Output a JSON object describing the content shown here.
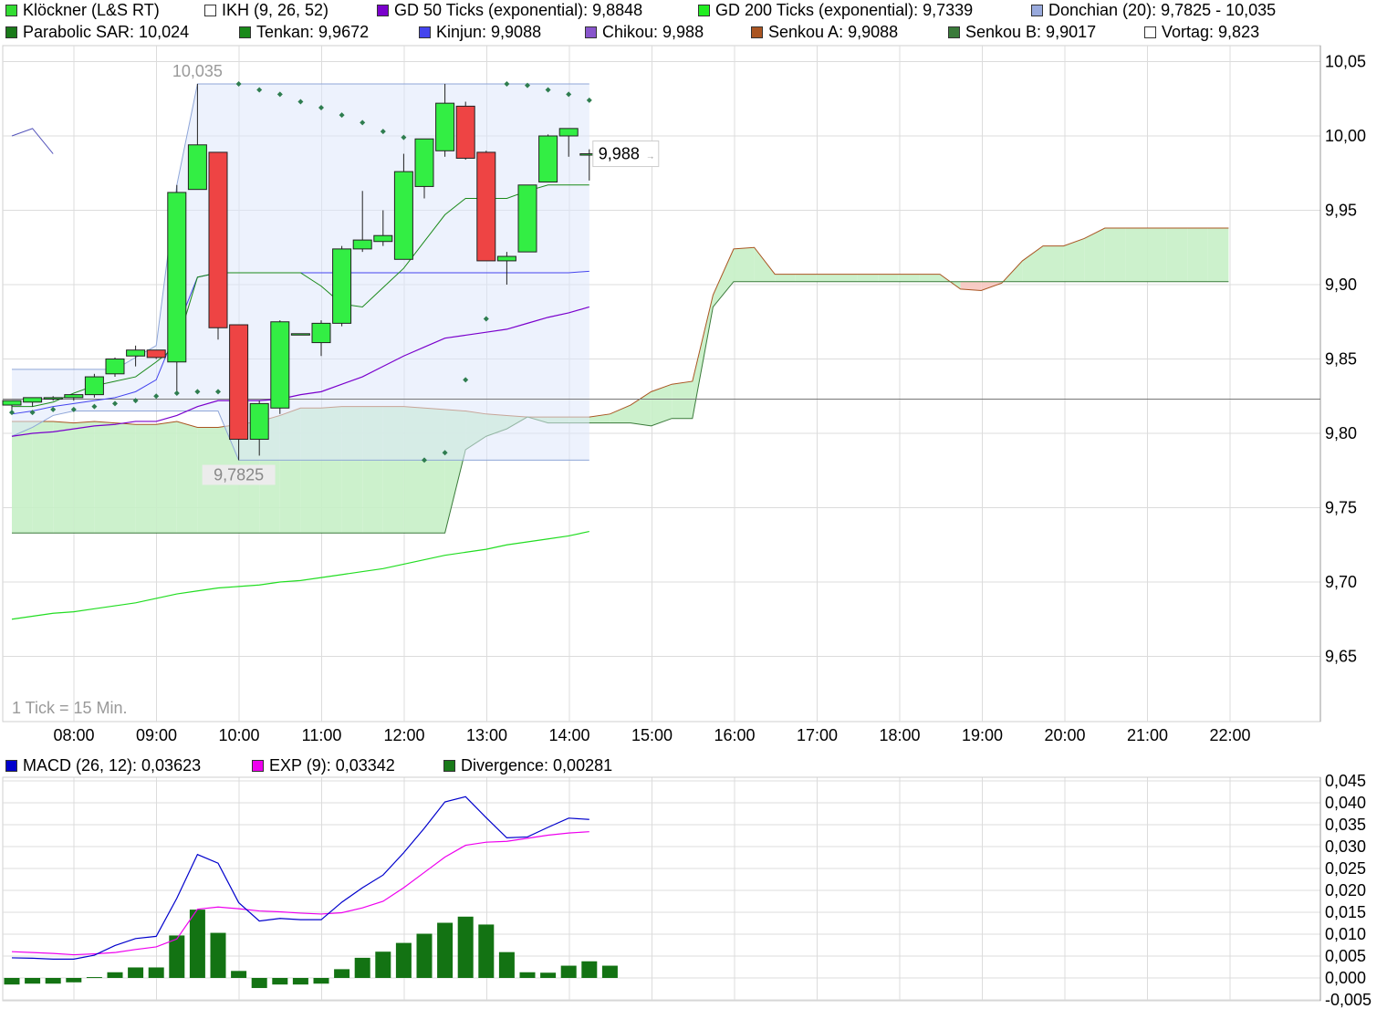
{
  "legend_top": [
    {
      "label": "Klöckner (L&S RT)",
      "color": "#33dd33"
    },
    {
      "label": "IKH (9, 26, 52)",
      "color": "#ffffff"
    },
    {
      "label": "GD 50 Ticks (exponential): 9,8848",
      "color": "#7a00cc"
    },
    {
      "label": "GD 200 Ticks (exponential): 9,7339",
      "color": "#22ee22"
    },
    {
      "label": "Donchian (20): 9,7825 - 10,035",
      "color": "#99aadd"
    },
    {
      "label": "Parabolic SAR: 10,024",
      "color": "#1a7a1a"
    },
    {
      "label": "Tenkan: 9,9672",
      "color": "#1a8a1a"
    },
    {
      "label": "Kinjun: 9,9088",
      "color": "#4444ee"
    },
    {
      "label": "Chikou: 9,988",
      "color": "#8855cc"
    },
    {
      "label": "Senkou A: 9,9088",
      "color": "#aa5522"
    },
    {
      "label": "Senkou B: 9,9017",
      "color": "#3a7a3a"
    },
    {
      "label": "Vortag: 9,823",
      "color": "#ffffff"
    }
  ],
  "legend_macd": [
    {
      "label": "MACD (26, 12): 0,03623",
      "color": "#0000cc"
    },
    {
      "label": "EXP (9): 0,03342",
      "color": "#ee00ee"
    },
    {
      "label": "Divergence: 0,00281",
      "color": "#1a7a1a"
    }
  ],
  "tick_note": "1 Tick = 15 Min.",
  "annotations": {
    "high": "10,035",
    "low": "9,7825",
    "last": "9,988"
  },
  "chart_data": [
    {
      "type": "candlestick",
      "title": "Klöckner (L&S RT)",
      "x_labels": [
        "08:00",
        "09:00",
        "10:00",
        "11:00",
        "12:00",
        "13:00",
        "14:00",
        "15:00",
        "16:00",
        "17:00",
        "18:00",
        "19:00",
        "20:00",
        "21:00",
        "22:00"
      ],
      "y_labels": [
        "10,05",
        "10,00",
        "9,95",
        "9,90",
        "9,85",
        "9,80",
        "9,75",
        "9,70",
        "9,65"
      ],
      "ylim": [
        9.615,
        10.063
      ],
      "vortag": 9.823,
      "candles": [
        {
          "t": "07:30",
          "o": 9.819,
          "h": 9.822,
          "l": 9.815,
          "c": 9.822
        },
        {
          "t": "07:45",
          "o": 9.821,
          "h": 9.824,
          "l": 9.818,
          "c": 9.824
        },
        {
          "t": "08:00",
          "o": 9.823,
          "h": 9.825,
          "l": 9.822,
          "c": 9.824
        },
        {
          "t": "08:15",
          "o": 9.824,
          "h": 9.826,
          "l": 9.822,
          "c": 9.826
        },
        {
          "t": "08:30",
          "o": 9.826,
          "h": 9.84,
          "l": 9.824,
          "c": 9.838
        },
        {
          "t": "08:45",
          "o": 9.84,
          "h": 9.851,
          "l": 9.838,
          "c": 9.85
        },
        {
          "t": "09:00",
          "o": 9.852,
          "h": 9.859,
          "l": 9.845,
          "c": 9.856
        },
        {
          "t": "09:15",
          "o": 9.856,
          "h": 9.856,
          "l": 9.85,
          "c": 9.851
        },
        {
          "t": "09:30",
          "o": 9.848,
          "h": 9.967,
          "l": 9.828,
          "c": 9.962
        },
        {
          "t": "09:45",
          "o": 9.964,
          "h": 10.035,
          "l": 9.964,
          "c": 9.994
        },
        {
          "t": "10:00",
          "o": 9.989,
          "h": 9.989,
          "l": 9.863,
          "c": 9.871
        },
        {
          "t": "10:15",
          "o": 9.873,
          "h": 9.873,
          "l": 9.782,
          "c": 9.796
        },
        {
          "t": "10:30",
          "o": 9.796,
          "h": 9.822,
          "l": 9.785,
          "c": 9.82
        },
        {
          "t": "10:45",
          "o": 9.817,
          "h": 9.876,
          "l": 9.813,
          "c": 9.875
        },
        {
          "t": "11:00",
          "o": 9.867,
          "h": 9.867,
          "l": 9.866,
          "c": 9.867
        },
        {
          "t": "11:15",
          "o": 9.861,
          "h": 9.876,
          "l": 9.852,
          "c": 9.874
        },
        {
          "t": "11:30",
          "o": 9.874,
          "h": 9.926,
          "l": 9.872,
          "c": 9.924
        },
        {
          "t": "11:45",
          "o": 9.924,
          "h": 9.963,
          "l": 9.922,
          "c": 9.93
        },
        {
          "t": "12:00",
          "o": 9.929,
          "h": 9.95,
          "l": 9.926,
          "c": 9.933
        },
        {
          "t": "12:15",
          "o": 9.917,
          "h": 9.988,
          "l": 9.917,
          "c": 9.976
        },
        {
          "t": "12:30",
          "o": 9.966,
          "h": 9.998,
          "l": 9.958,
          "c": 9.998
        },
        {
          "t": "12:45",
          "o": 9.99,
          "h": 10.035,
          "l": 9.986,
          "c": 10.022
        },
        {
          "t": "13:00",
          "o": 10.02,
          "h": 10.023,
          "l": 9.984,
          "c": 9.985
        },
        {
          "t": "13:15",
          "o": 9.989,
          "h": 9.99,
          "l": 9.916,
          "c": 9.916
        },
        {
          "t": "13:30",
          "o": 9.916,
          "h": 9.922,
          "l": 9.9,
          "c": 9.919
        },
        {
          "t": "13:45",
          "o": 9.922,
          "h": 9.967,
          "l": 9.922,
          "c": 9.967
        },
        {
          "t": "14:00",
          "o": 9.969,
          "h": 10.001,
          "l": 9.969,
          "c": 10.0
        },
        {
          "t": "14:15",
          "o": 10.0,
          "h": 10.005,
          "l": 9.986,
          "c": 10.005
        },
        {
          "t": "14:30",
          "o": 9.988,
          "h": 9.991,
          "l": 9.97,
          "c": 9.988
        }
      ],
      "sar": [
        9.814,
        9.814,
        9.816,
        9.816,
        9.818,
        9.82,
        9.822,
        9.825,
        9.827,
        9.828,
        9.828,
        10.035,
        10.031,
        10.028,
        10.023,
        10.019,
        10.014,
        10.009,
        10.003,
        9.999,
        9.782,
        9.787,
        9.836,
        9.877,
        10.035,
        10.034,
        10.031,
        10.028,
        10.024
      ],
      "gd50": [
        9.798,
        9.8,
        9.801,
        9.803,
        9.805,
        9.806,
        9.808,
        9.808,
        9.812,
        9.818,
        9.822,
        9.822,
        9.822,
        9.823,
        9.826,
        9.828,
        9.833,
        9.838,
        9.845,
        9.852,
        9.858,
        9.864,
        9.866,
        9.868,
        9.87,
        9.874,
        9.878,
        9.881,
        9.885
      ],
      "gd200": [
        9.675,
        9.677,
        9.679,
        9.68,
        9.682,
        9.684,
        9.686,
        9.689,
        9.692,
        9.694,
        9.696,
        9.697,
        9.698,
        9.7,
        9.701,
        9.703,
        9.705,
        9.707,
        9.709,
        9.712,
        9.715,
        9.718,
        9.72,
        9.722,
        9.725,
        9.727,
        9.729,
        9.731,
        9.734
      ],
      "tenkan": [
        9.818,
        9.818,
        9.821,
        9.827,
        9.832,
        9.835,
        9.838,
        9.848,
        9.859,
        9.905,
        9.908,
        9.908,
        9.908,
        9.908,
        9.908,
        9.899,
        9.887,
        9.885,
        9.898,
        9.911,
        9.929,
        9.947,
        9.958,
        9.958,
        9.958,
        9.963,
        9.967,
        9.967,
        9.967
      ],
      "kinjun": [
        9.813,
        9.815,
        9.818,
        9.82,
        9.822,
        9.824,
        9.828,
        9.836,
        9.87,
        9.905,
        9.908,
        9.908,
        9.908,
        9.908,
        9.908,
        9.908,
        9.908,
        9.908,
        9.908,
        9.908,
        9.908,
        9.908,
        9.908,
        9.908,
        9.908,
        9.908,
        9.908,
        9.908,
        9.909
      ],
      "chikou": [
        10.0,
        10.005,
        9.988
      ],
      "donchian_high": [
        9.843,
        9.843,
        9.843,
        9.843,
        9.843,
        9.843,
        9.851,
        9.859,
        9.967,
        10.035,
        10.035,
        10.035,
        10.035,
        10.035,
        10.035,
        10.035,
        10.035,
        10.035,
        10.035,
        10.035,
        10.035,
        10.035,
        10.035,
        10.035,
        10.035,
        10.035,
        10.035,
        10.035,
        10.035
      ],
      "donchian_low": [
        9.798,
        9.804,
        9.812,
        9.815,
        9.815,
        9.815,
        9.815,
        9.815,
        9.815,
        9.815,
        9.815,
        9.782,
        9.782,
        9.782,
        9.782,
        9.782,
        9.782,
        9.782,
        9.782,
        9.782,
        9.782,
        9.782,
        9.782,
        9.782,
        9.782,
        9.782,
        9.782,
        9.782,
        9.782
      ],
      "senkou_a": [
        9.808,
        9.808,
        9.808,
        9.807,
        9.808,
        9.807,
        9.806,
        9.806,
        9.808,
        9.804,
        9.804,
        9.806,
        9.808,
        9.812,
        9.817,
        9.817,
        9.818,
        9.818,
        9.818,
        9.818,
        9.817,
        9.816,
        9.815,
        9.813,
        9.812,
        9.811,
        9.811,
        9.811,
        9.811,
        9.813,
        9.819,
        9.828,
        9.833,
        9.835,
        9.893,
        9.924,
        9.925,
        9.907,
        9.907,
        9.907,
        9.907,
        9.907,
        9.907,
        9.907,
        9.907,
        9.907,
        9.897,
        9.896,
        9.901,
        9.916,
        9.926,
        9.926,
        9.931,
        9.938,
        9.938,
        9.938,
        9.938,
        9.938,
        9.938,
        9.938
      ],
      "senkou_b": [
        9.733,
        9.733,
        9.733,
        9.733,
        9.733,
        9.733,
        9.733,
        9.733,
        9.733,
        9.733,
        9.733,
        9.733,
        9.733,
        9.733,
        9.733,
        9.733,
        9.733,
        9.733,
        9.733,
        9.733,
        9.733,
        9.733,
        9.789,
        9.798,
        9.803,
        9.811,
        9.807,
        9.807,
        9.807,
        9.807,
        9.807,
        9.805,
        9.81,
        9.81,
        9.885,
        9.902,
        9.902,
        9.902,
        9.902,
        9.902,
        9.902,
        9.902,
        9.902,
        9.902,
        9.902,
        9.902,
        9.902,
        9.902,
        9.902,
        9.902,
        9.902,
        9.902,
        9.902,
        9.902,
        9.902,
        9.902,
        9.902,
        9.902,
        9.902,
        9.902
      ]
    },
    {
      "type": "line_bar",
      "title": "MACD (26, 12)",
      "x_labels": [
        "08:00",
        "09:00",
        "10:00",
        "11:00",
        "12:00",
        "13:00",
        "14:00",
        "15:00",
        "16:00",
        "17:00",
        "18:00",
        "19:00",
        "20:00",
        "21:00",
        "22:00"
      ],
      "y_labels": [
        "0,045",
        "0,040",
        "0,035",
        "0,030",
        "0,025",
        "0,020",
        "0,015",
        "0,010",
        "0,005",
        "0,000",
        "-0,005"
      ],
      "ylim": [
        -0.0055,
        0.0455
      ],
      "macd": [
        0.0046,
        0.0045,
        0.0043,
        0.0043,
        0.0052,
        0.0074,
        0.009,
        0.0095,
        0.0182,
        0.0282,
        0.0262,
        0.0172,
        0.013,
        0.0136,
        0.0133,
        0.0133,
        0.0173,
        0.0206,
        0.0235,
        0.0286,
        0.0342,
        0.0402,
        0.0414,
        0.0366,
        0.032,
        0.0322,
        0.0344,
        0.0365,
        0.0362
      ],
      "exp": [
        0.006,
        0.0058,
        0.0056,
        0.0053,
        0.0055,
        0.0058,
        0.0065,
        0.0071,
        0.0089,
        0.0157,
        0.0162,
        0.0158,
        0.0153,
        0.0151,
        0.0148,
        0.0146,
        0.0149,
        0.016,
        0.0175,
        0.0206,
        0.0241,
        0.0276,
        0.0303,
        0.031,
        0.0312,
        0.0319,
        0.0326,
        0.0331,
        0.0334
      ],
      "divergence": [
        -0.0015,
        -0.0013,
        -0.0013,
        -0.001,
        0.0002,
        0.0013,
        0.0024,
        0.0024,
        0.0097,
        0.0156,
        0.0103,
        0.0016,
        -0.0023,
        -0.0015,
        -0.0015,
        -0.0013,
        0.002,
        0.0046,
        0.006,
        0.008,
        0.0101,
        0.0126,
        0.014,
        0.0122,
        0.0059,
        0.0013,
        0.0012,
        0.0028,
        0.0038,
        0.0028
      ]
    }
  ]
}
